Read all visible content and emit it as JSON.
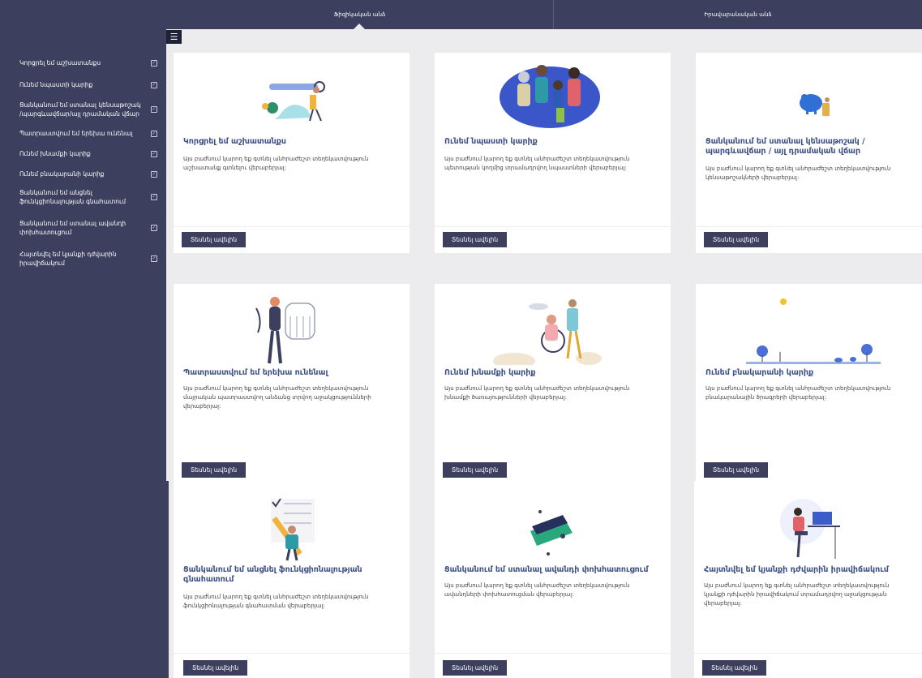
{
  "tabs": {
    "individual": "Ֆիզիկական անձ",
    "legal": "Իրավաբանական անձ"
  },
  "sidebar": {
    "items": [
      {
        "label": "Կորցրել եմ աշխատանքս"
      },
      {
        "label": "Ունեմ նպաստի կարիք"
      },
      {
        "label": "Ցանկանում եմ ստանալ կենսաթոշակ /պարգևավճար/այլ դրամական վճար"
      },
      {
        "label": "Պատրաստվում եմ երեխա ունենալ"
      },
      {
        "label": "Ունեմ խնամքի կարիք"
      },
      {
        "label": "Ունեմ բնակարանի կարիք"
      },
      {
        "label": "Ցանկանում եմ անցնել ֆունկցիոնալության գնահատում"
      },
      {
        "label": "Ցանկանում եմ ստանալ ավանդի փոխհատուցում"
      },
      {
        "label": "Հայտնվել եմ կյանքի դժվարին իրավիճակում"
      }
    ]
  },
  "menu_icon": "list-icon",
  "button_label": "Տեսնել ավելին",
  "cards": [
    {
      "title": "Կորցրել եմ աշխատանքս",
      "desc": "Այս բաժնում կարող եք գտնել անհրաժեշտ տեղեկատվություն աշխատանք գտնելու վերաբերյալ:",
      "icon": "job-search-illustration"
    },
    {
      "title": "Ունեմ նպաստի կարիք",
      "desc": "Այս բաժնում կարող եք գտնել անհրաժեշտ տեղեկատվություն պետության կողմից տրամադրվող նպաստների վերաբերյալ:",
      "icon": "family-illustration"
    },
    {
      "title": "Ցանկանում եմ ստանալ կենսաթոշակ / պարգևավճար / այլ դրամական վճար",
      "desc": "Այս բաժնում կարող եք գտնել անհրաժեշտ տեղեկատվություն կենսաթոշակների վերաբերյալ:",
      "icon": "piggy-bank-illustration"
    },
    {
      "title": "Պատրաստվում եմ երեխա ունենալ",
      "desc": "Այս բաժնում կարող եք գտնել անհրաժեշտ տեղեկատվություն մայրական պատրաստվող անձանց տրվող աջակցությունների վերաբերյալ:",
      "icon": "pregnancy-illustration"
    },
    {
      "title": "Ունեմ խնամքի կարիք",
      "desc": "Այս բաժնում կարող եք գտնել անհրաժեշտ տեղեկատվություն խնամքի ծառայությունների վերաբերյալ:",
      "icon": "care-illustration"
    },
    {
      "title": "Ունեմ բնակարանի կարիք",
      "desc": "Այս բաժնում կարող եք գտնել անհրաժեշտ տեղեկատվություն բնակարանային ծրագրերի վերաբերյալ:",
      "icon": "housing-illustration"
    },
    {
      "title": "Ցանկանում եմ անցնել ֆունկցիոնալության գնահատում",
      "desc": "Այս բաժնում կարող եք գտնել անհրաժեշտ տեղեկատվություն ֆունկցիոնալության գնահատման վերաբերյալ:",
      "icon": "checklist-illustration"
    },
    {
      "title": "Ցանկանում եմ ստանալ ավանդի փոխհատուցում",
      "desc": "Այս բաժնում կարող եք գտնել անհրաժեշտ տեղեկատվություն ավանդների փոխհատուցման վերաբերյալ:",
      "icon": "deposit-card-illustration"
    },
    {
      "title": "Հայտնվել եմ կյանքի դժվարին իրավիճակում",
      "desc": "Այս բաժնում կարող եք գտնել անհրաժեշտ տեղեկատվություն կյանքի դժվարին իրավիճակում տրամադրվող աջակցության վերաբերյալ:",
      "icon": "laptop-person-illustration"
    }
  ],
  "colors": {
    "primary": "#3c3f5e",
    "title": "#3c4f86",
    "background": "#ececee"
  }
}
